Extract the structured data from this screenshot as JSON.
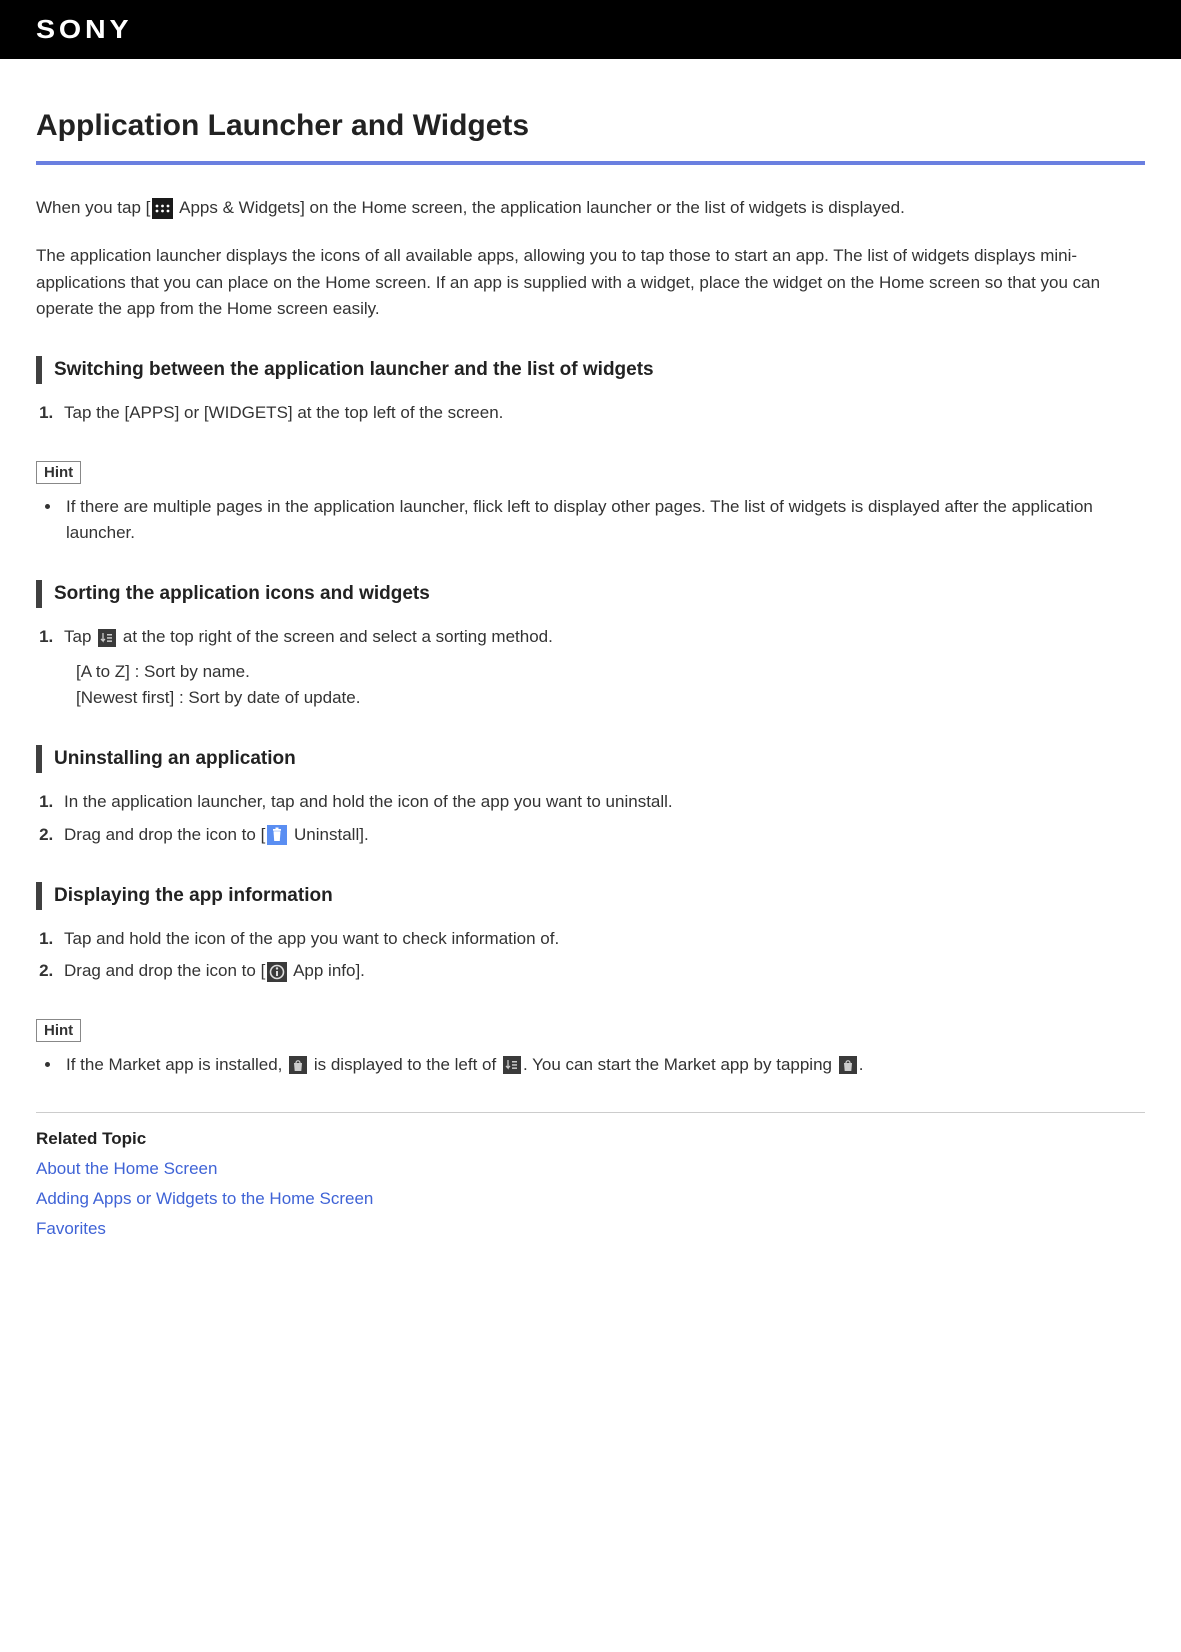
{
  "header": {
    "brand": "SONY"
  },
  "page": {
    "title": "Application Launcher and Widgets",
    "intro1_a": "When you tap [",
    "intro1_b": " Apps & Widgets] on the Home screen, the application launcher or the list of widgets is displayed.",
    "intro2": "The application launcher displays the icons of all available apps, allowing you to tap those to start an app. The list of widgets displays mini-applications that you can place on the Home screen. If an app is supplied with a widget, place the widget on the Home screen so that you can operate the app from the Home screen easily."
  },
  "sections": {
    "switching": {
      "heading": "Switching between the application launcher and the list of widgets",
      "step1": "Tap the [APPS] or [WIDGETS] at the top left of the screen."
    },
    "hint1": {
      "label": "Hint",
      "text": "If there are multiple pages in the application launcher, flick left to display other pages. The list of widgets is displayed after the application launcher."
    },
    "sorting": {
      "heading": "Sorting the application icons and widgets",
      "step1_a": "Tap ",
      "step1_b": " at the top right of the screen and select a sorting method.",
      "line2": "[A to Z] : Sort by name.",
      "line3": "[Newest first] : Sort by date of update."
    },
    "uninstalling": {
      "heading": "Uninstalling an application",
      "step1": "In the application launcher, tap and hold the icon of the app you want to uninstall.",
      "step2_a": "Drag and drop the icon to [",
      "step2_b": " Uninstall]."
    },
    "appinfo": {
      "heading": "Displaying the app information",
      "step1": "Tap and hold the icon of the app you want to check information of.",
      "step2_a": "Drag and drop the icon to [",
      "step2_b": " App info]."
    },
    "hint2": {
      "label": "Hint",
      "text_a": "If the Market app is installed, ",
      "text_b": " is displayed to the left of ",
      "text_c": ". You can start the Market app by tapping ",
      "text_d": "."
    }
  },
  "related": {
    "heading": "Related Topic",
    "links": [
      "About the Home Screen",
      "Adding Apps or Widgets to the Home Screen",
      "Favorites"
    ]
  }
}
